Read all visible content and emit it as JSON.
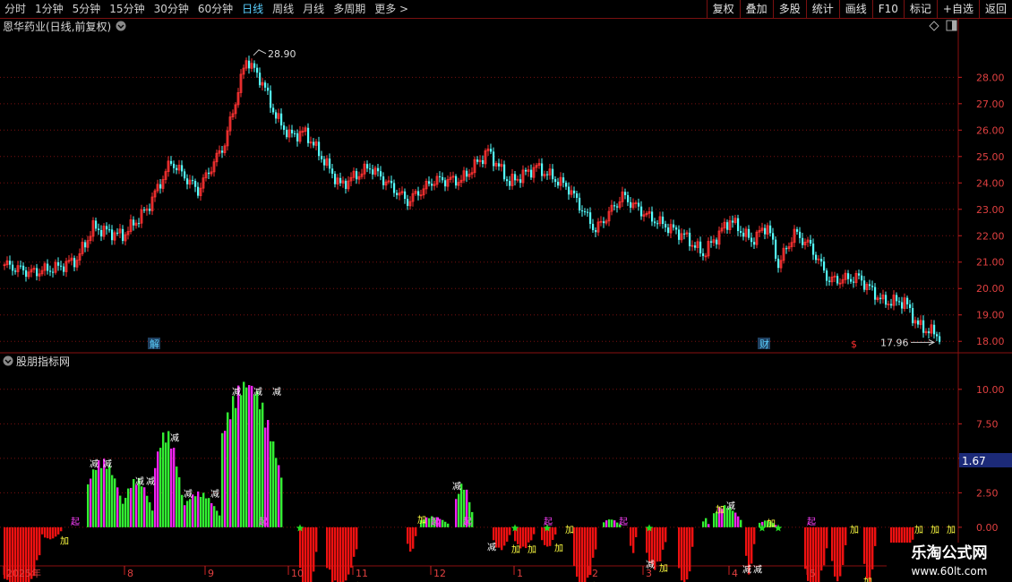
{
  "toolbar": {
    "periods": [
      {
        "label": "分时",
        "active": false
      },
      {
        "label": "1分钟",
        "active": false
      },
      {
        "label": "5分钟",
        "active": false
      },
      {
        "label": "15分钟",
        "active": false
      },
      {
        "label": "30分钟",
        "active": false
      },
      {
        "label": "60分钟",
        "active": false
      },
      {
        "label": "日线",
        "active": true
      },
      {
        "label": "周线",
        "active": false
      },
      {
        "label": "月线",
        "active": false
      },
      {
        "label": "多周期",
        "active": false
      },
      {
        "label": "更多 >",
        "active": false
      }
    ],
    "tools": [
      "复权",
      "叠加",
      "多股",
      "统计",
      "画线",
      "F10",
      "标记",
      "+自选",
      "返回"
    ]
  },
  "price_panel": {
    "title": "恩华药业(日线,前复权)",
    "high_label": "28.90",
    "low_label": "17.96",
    "markers": [
      {
        "text": "解",
        "color": "#5ad0ff",
        "day": 56
      },
      {
        "text": "财",
        "color": "#5ad0ff",
        "day": 283
      },
      {
        "text": "$",
        "color": "#ff3030",
        "day": 317
      }
    ]
  },
  "indicator_panel": {
    "title": "股朋指标网",
    "current_value": "1.67",
    "signal_labels": {
      "add": "加",
      "reduce": "减",
      "start": "起"
    }
  },
  "timeline": {
    "labels": [
      {
        "text": "2025年",
        "day": 0
      },
      {
        "text": "8",
        "day": 45
      },
      {
        "text": "9",
        "day": 75
      },
      {
        "text": "10",
        "day": 106
      },
      {
        "text": "11",
        "day": 130
      },
      {
        "text": "12",
        "day": 159
      },
      {
        "text": "1",
        "day": 190
      },
      {
        "text": "2",
        "day": 218
      },
      {
        "text": "3",
        "day": 238
      },
      {
        "text": "4",
        "day": 270
      },
      {
        "text": "5",
        "day": 299
      }
    ]
  },
  "watermark": {
    "line1": "乐淘公式网",
    "line2": "www.60lt.com"
  },
  "chart_data": [
    {
      "type": "candlestick",
      "title": "恩华药业(日线,前复权)",
      "ylim": [
        17.6,
        29.3
      ],
      "yticks": [
        18.0,
        19.0,
        20.0,
        21.0,
        22.0,
        23.0,
        24.0,
        25.0,
        26.0,
        27.0,
        28.0
      ],
      "grid": true,
      "anchors": [
        [
          0,
          20.9
        ],
        [
          10,
          20.6
        ],
        [
          20,
          20.8
        ],
        [
          27,
          21.1
        ],
        [
          33,
          22.3
        ],
        [
          44,
          22.0
        ],
        [
          53,
          23.0
        ],
        [
          62,
          24.8
        ],
        [
          72,
          23.7
        ],
        [
          82,
          25.5
        ],
        [
          90,
          28.7
        ],
        [
          96,
          27.8
        ],
        [
          101,
          26.5
        ],
        [
          106,
          25.8
        ],
        [
          112,
          25.9
        ],
        [
          125,
          23.9
        ],
        [
          136,
          24.6
        ],
        [
          150,
          23.3
        ],
        [
          160,
          24.1
        ],
        [
          170,
          24.1
        ],
        [
          180,
          25.2
        ],
        [
          188,
          24.0
        ],
        [
          198,
          24.6
        ],
        [
          210,
          23.8
        ],
        [
          220,
          22.2
        ],
        [
          230,
          23.5
        ],
        [
          240,
          22.7
        ],
        [
          253,
          22.0
        ],
        [
          260,
          21.3
        ],
        [
          270,
          22.6
        ],
        [
          278,
          21.8
        ],
        [
          284,
          22.4
        ],
        [
          288,
          20.9
        ],
        [
          294,
          22.1
        ],
        [
          300,
          21.6
        ],
        [
          307,
          20.3
        ],
        [
          318,
          20.4
        ],
        [
          327,
          19.5
        ],
        [
          335,
          19.5
        ],
        [
          340,
          18.6
        ],
        [
          348,
          18.2
        ]
      ],
      "high": {
        "day": 93,
        "value": 28.9
      },
      "low": {
        "day": 347,
        "value": 17.96
      }
    },
    {
      "type": "bar",
      "name": "股朋指标网",
      "ylim": [
        -2.8,
        12.0
      ],
      "yticks": [
        0.0,
        2.5,
        5.0,
        7.5,
        10.0
      ],
      "current": 1.67,
      "segments": [
        {
          "start": 0,
          "end": 13,
          "peak": -5.8
        },
        {
          "start": 14,
          "end": 21,
          "peak": -0.9
        },
        {
          "start": 31,
          "end": 44,
          "peak": 5.0
        },
        {
          "start": 45,
          "end": 55,
          "peak": 3.6
        },
        {
          "start": 56,
          "end": 66,
          "peak": 7.1
        },
        {
          "start": 67,
          "end": 80,
          "peak": 2.6
        },
        {
          "start": 81,
          "end": 103,
          "peak": 10.8
        },
        {
          "start": 110,
          "end": 116,
          "peak": -5.3
        },
        {
          "start": 120,
          "end": 131,
          "peak": -4.6
        },
        {
          "start": 150,
          "end": 153,
          "peak": -1.9
        },
        {
          "start": 155,
          "end": 165,
          "peak": 0.8
        },
        {
          "start": 168,
          "end": 174,
          "peak": 3.2
        },
        {
          "start": 182,
          "end": 188,
          "peak": -1.7
        },
        {
          "start": 190,
          "end": 197,
          "peak": -1.6
        },
        {
          "start": 200,
          "end": 205,
          "peak": -1.5
        },
        {
          "start": 212,
          "end": 220,
          "peak": -4.6
        },
        {
          "start": 223,
          "end": 229,
          "peak": 0.6
        },
        {
          "start": 233,
          "end": 235,
          "peak": -2.1
        },
        {
          "start": 239,
          "end": 246,
          "peak": -3.1
        },
        {
          "start": 251,
          "end": 256,
          "peak": -4.7
        },
        {
          "start": 260,
          "end": 262,
          "peak": 0.7
        },
        {
          "start": 264,
          "end": 274,
          "peak": 1.6
        },
        {
          "start": 276,
          "end": 279,
          "peak": -3.5
        },
        {
          "start": 281,
          "end": 287,
          "peak": 0.5
        },
        {
          "start": 298,
          "end": 306,
          "peak": -4.9
        },
        {
          "start": 308,
          "end": 313,
          "peak": -4.1
        },
        {
          "start": 320,
          "end": 324,
          "peak": -4.2
        },
        {
          "start": 330,
          "end": 338,
          "peak": -2.6
        }
      ],
      "signals": [
        {
          "day": 2,
          "kind": "add"
        },
        {
          "day": 4,
          "kind": "add"
        },
        {
          "day": 13,
          "kind": "add"
        },
        {
          "day": 22,
          "kind": "add"
        },
        {
          "day": 26,
          "kind": "start"
        },
        {
          "day": 33,
          "kind": "reduce"
        },
        {
          "day": 38,
          "kind": "reduce"
        },
        {
          "day": 50,
          "kind": "reduce"
        },
        {
          "day": 54,
          "kind": "reduce"
        },
        {
          "day": 63,
          "kind": "reduce"
        },
        {
          "day": 68,
          "kind": "reduce"
        },
        {
          "day": 78,
          "kind": "reduce"
        },
        {
          "day": 86,
          "kind": "reduce"
        },
        {
          "day": 94,
          "kind": "reduce"
        },
        {
          "day": 101,
          "kind": "reduce"
        },
        {
          "day": 96,
          "kind": "start"
        },
        {
          "day": 113,
          "kind": "add"
        },
        {
          "day": 126,
          "kind": "add"
        },
        {
          "day": 132,
          "kind": "add"
        },
        {
          "day": 155,
          "kind": "add"
        },
        {
          "day": 160,
          "kind": "start"
        },
        {
          "day": 168,
          "kind": "reduce"
        },
        {
          "day": 172,
          "kind": "start"
        },
        {
          "day": 181,
          "kind": "reduce"
        },
        {
          "day": 190,
          "kind": "add"
        },
        {
          "day": 196,
          "kind": "add"
        },
        {
          "day": 202,
          "kind": "start"
        },
        {
          "day": 206,
          "kind": "add"
        },
        {
          "day": 210,
          "kind": "add"
        },
        {
          "day": 220,
          "kind": "add"
        },
        {
          "day": 230,
          "kind": "start"
        },
        {
          "day": 240,
          "kind": "reduce"
        },
        {
          "day": 245,
          "kind": "add"
        },
        {
          "day": 252,
          "kind": "add"
        },
        {
          "day": 266,
          "kind": "add"
        },
        {
          "day": 270,
          "kind": "reduce"
        },
        {
          "day": 276,
          "kind": "reduce"
        },
        {
          "day": 280,
          "kind": "reduce"
        },
        {
          "day": 285,
          "kind": "add"
        },
        {
          "day": 300,
          "kind": "start"
        },
        {
          "day": 305,
          "kind": "reduce"
        },
        {
          "day": 316,
          "kind": "add"
        },
        {
          "day": 321,
          "kind": "add"
        },
        {
          "day": 340,
          "kind": "add"
        },
        {
          "day": 346,
          "kind": "add"
        },
        {
          "day": 352,
          "kind": "add"
        }
      ],
      "stars": [
        110,
        190,
        202,
        240,
        282,
        288
      ]
    }
  ]
}
